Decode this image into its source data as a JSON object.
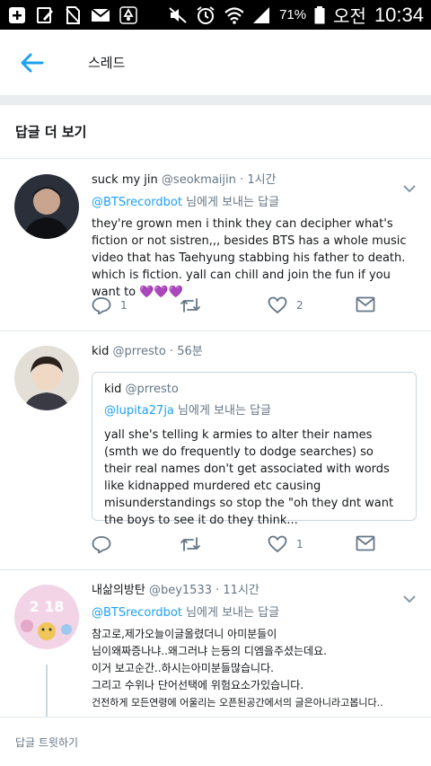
{
  "status_bar": {
    "battery_percent": "71%",
    "am_pm": "오전",
    "time": "10:34",
    "icons": [
      "add-icon",
      "edit-icon",
      "no-sim-icon",
      "mail-icon",
      "recycle-icon",
      "mute-icon",
      "alarm-icon",
      "wifi-icon",
      "signal-icon",
      "battery-icon"
    ]
  },
  "app_bar": {
    "title": "스레드",
    "back_icon": "arrow-left-icon"
  },
  "section": {
    "title": "답글 더 보기"
  },
  "tweets": [
    {
      "name": "suck my jin",
      "handle": "@seokmaijin",
      "dot": "·",
      "time": "1시간",
      "reply_mention": "@BTSrecordbot",
      "reply_suffix": " 님에게 보내는 답글",
      "text": "they're grown men i think they can decipher what's fiction or not sistren,,, besides BTS has a whole music video that has Taehyung stabbing his father to death. which is fiction. yall can chill and join the fun if you want to 💜💜💜",
      "reply_count": "1",
      "like_count": "2"
    },
    {
      "name": "kid",
      "handle": "@prresto",
      "dot": "·",
      "time": "56분",
      "quote": {
        "name": "kid",
        "handle": "@prresto",
        "reply_mention": "@lupita27ja",
        "reply_suffix": " 님에게 보내는 답글",
        "text": "yall she's telling k armies to alter their names (smth we do frequently to dodge searches) so their real names don't get associated with words like kidnapped murdered etc causing misunderstandings so stop the \"oh they dnt want the boys to see it do they think..."
      },
      "like_count": "1"
    },
    {
      "name": "내삶의방탄",
      "handle": "@bey1533",
      "dot": "·",
      "time": "11시간",
      "reply_mention": "@BTSrecordbot",
      "reply_suffix": " 님에게 보내는 답글",
      "text_lines": [
        "참고로,제가오늘이글올렸더니 아미분들이",
        "님이왜짜증나냐..왜그러냐 는등의 디엠을주셨는데요.",
        "이거 보고순간..하시는아미분들많습니다.",
        "그리고 수위나 단어선택에 위험요소가있습니다.",
        "건전하게 모든연령에 어울리는 오픈된공간에서의 글은아니라고봅니다.."
      ],
      "avatar_text": "2 18"
    }
  ],
  "composer": {
    "placeholder": "답글 트윗하기"
  },
  "colors": {
    "accent": "#1da1f2",
    "secondary_text": "#657786",
    "divider": "#e1e8ed",
    "heart_purple": "#a03ce6"
  }
}
